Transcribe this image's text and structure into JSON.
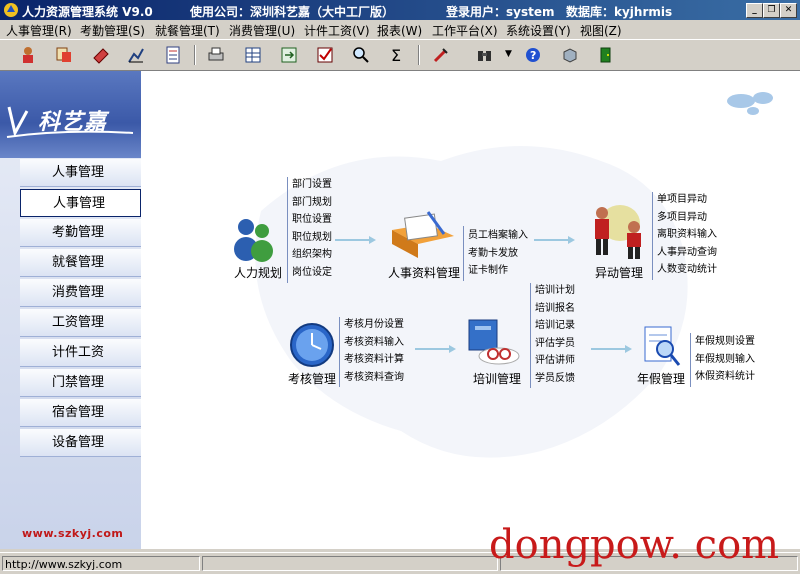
{
  "titlebar": {
    "app": "人力资源管理系统 V9.0",
    "company": "使用公司：深圳科艺嘉（大中工厂版）",
    "user": "登录用户：system",
    "database": "数据库：kyjhrmis"
  },
  "menu": [
    "人事管理(R)",
    "考勤管理(S)",
    "就餐管理(T)",
    "消费管理(U)",
    "计件工资(V)",
    "报表(W)",
    "工作平台(X)",
    "系统设置(Y)",
    "视图(Z)"
  ],
  "sidebar": {
    "logo": "科艺嘉",
    "items": [
      "人事管理",
      "人事管理",
      "考勤管理",
      "就餐管理",
      "消费管理",
      "工资管理",
      "计件工资",
      "门禁管理",
      "宿舍管理",
      "设备管理"
    ],
    "website": "www.szkyj.com"
  },
  "modules": {
    "hr_planning": {
      "label": "人力规划",
      "items": [
        "部门设置",
        "部门规划",
        "职位设置",
        "职位规划",
        "组织架构",
        "岗位设定"
      ]
    },
    "hr_records": {
      "label": "人事资料管理",
      "items": [
        "员工档案输入",
        "考勤卡发放",
        "证卡制作"
      ]
    },
    "changes": {
      "label": "异动管理",
      "items": [
        "单项目异动",
        "多项目异动",
        "离职资料输入",
        "人事异动查询",
        "人数变动统计"
      ]
    },
    "assessment": {
      "label": "考核管理",
      "items": [
        "考核月份设置",
        "考核资料输入",
        "考核资料计算",
        "考核资料查询"
      ]
    },
    "training": {
      "label": "培训管理",
      "items": [
        "培训计划",
        "培训报名",
        "培训记录",
        "评估学员",
        "评估讲师",
        "学员反馈"
      ]
    },
    "annual_leave": {
      "label": "年假管理",
      "items": [
        "年假规则设置",
        "年假规则输入",
        "休假资料统计"
      ]
    }
  },
  "status": {
    "url": "http://www.szkyj.com"
  },
  "watermark": "dongpow. com"
}
